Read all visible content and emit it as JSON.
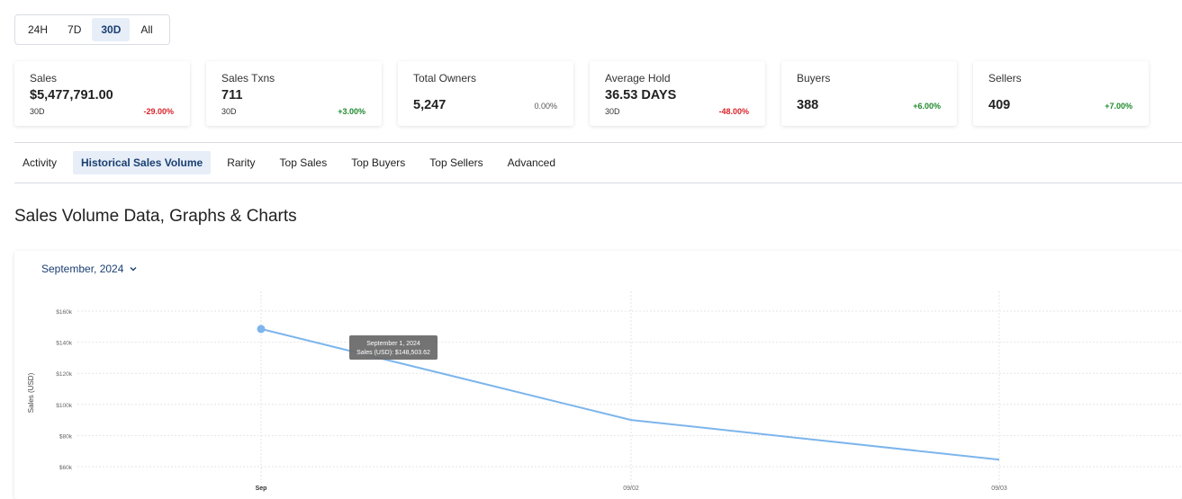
{
  "range": {
    "options": [
      "24H",
      "7D",
      "30D",
      "All"
    ],
    "selected": "30D"
  },
  "stats": [
    {
      "label": "Sales",
      "value": "$5,477,791.00",
      "period": "30D",
      "change": "-29.00%",
      "trend": "neg"
    },
    {
      "label": "Sales Txns",
      "value": "711",
      "period": "30D",
      "change": "+3.00%",
      "trend": "pos"
    },
    {
      "label": "Total Owners",
      "value": "5,247",
      "period": "",
      "change": "0.00%",
      "trend": "neu"
    },
    {
      "label": "Average Hold",
      "value": "36.53 DAYS",
      "period": "30D",
      "change": "-48.00%",
      "trend": "neg"
    },
    {
      "label": "Buyers",
      "value": "388",
      "period": "",
      "change": "+6.00%",
      "trend": "pos"
    },
    {
      "label": "Sellers",
      "value": "409",
      "period": "",
      "change": "+7.00%",
      "trend": "pos"
    }
  ],
  "tabs": {
    "items": [
      "Activity",
      "Historical Sales Volume",
      "Rarity",
      "Top Sales",
      "Top Buyers",
      "Top Sellers",
      "Advanced"
    ],
    "active": "Historical Sales Volume"
  },
  "section": {
    "title": "Sales Volume Data, Graphs & Charts"
  },
  "month_picker": {
    "label": "September, 2024",
    "icon": "chevron-down-icon"
  },
  "colors": {
    "accent": "#1b3f72",
    "active_bg": "#e7eef8",
    "negative": "#d8232a",
    "positive": "#1f8a2e",
    "line": "#7cb5ec",
    "tooltip_bg": "#6b6b6b"
  },
  "chart_data": {
    "type": "line",
    "x": [
      "Sep",
      "09/02",
      "09/03"
    ],
    "series": [
      {
        "values": [
          148503.62,
          90000,
          64500
        ]
      }
    ],
    "ylabel": "Sales (USD)",
    "yticks": [
      "$60k",
      "$80k",
      "$100k",
      "$120k",
      "$140k",
      "$160k"
    ],
    "ylim": [
      50000,
      170000
    ],
    "grid": true,
    "tooltip": {
      "title": "September 1, 2024",
      "text": "Sales (USD): $148,503.62"
    }
  }
}
